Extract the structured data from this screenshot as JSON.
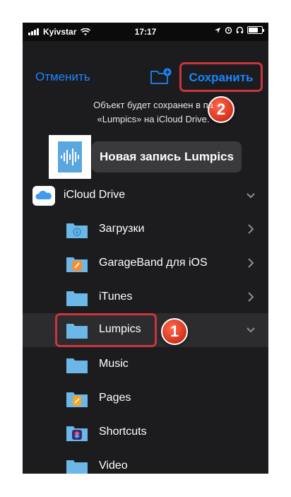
{
  "status_bar": {
    "carrier": "Kyivstar",
    "time": "17:17"
  },
  "header": {
    "cancel_label": "Отменить",
    "save_label": "Сохранить"
  },
  "info": {
    "line1": "Объект будет сохранен в па",
    "line2": "«Lumpics» на iCloud Drive."
  },
  "file": {
    "name": "Новая запись Lumpics"
  },
  "folders": {
    "root": "iCloud Drive",
    "items": [
      {
        "label": "Загрузки"
      },
      {
        "label": "GarageBand для iOS"
      },
      {
        "label": "iTunes"
      },
      {
        "label": "Lumpics"
      },
      {
        "label": "Music"
      },
      {
        "label": "Pages"
      },
      {
        "label": "Shortcuts"
      },
      {
        "label": "Video"
      }
    ]
  },
  "annotations": {
    "step1": "1",
    "step2": "2"
  },
  "colors": {
    "accent": "#1a85ff",
    "background": "#1c1c1e",
    "folder": "#6bb7e8",
    "highlight": "#c9353f"
  }
}
